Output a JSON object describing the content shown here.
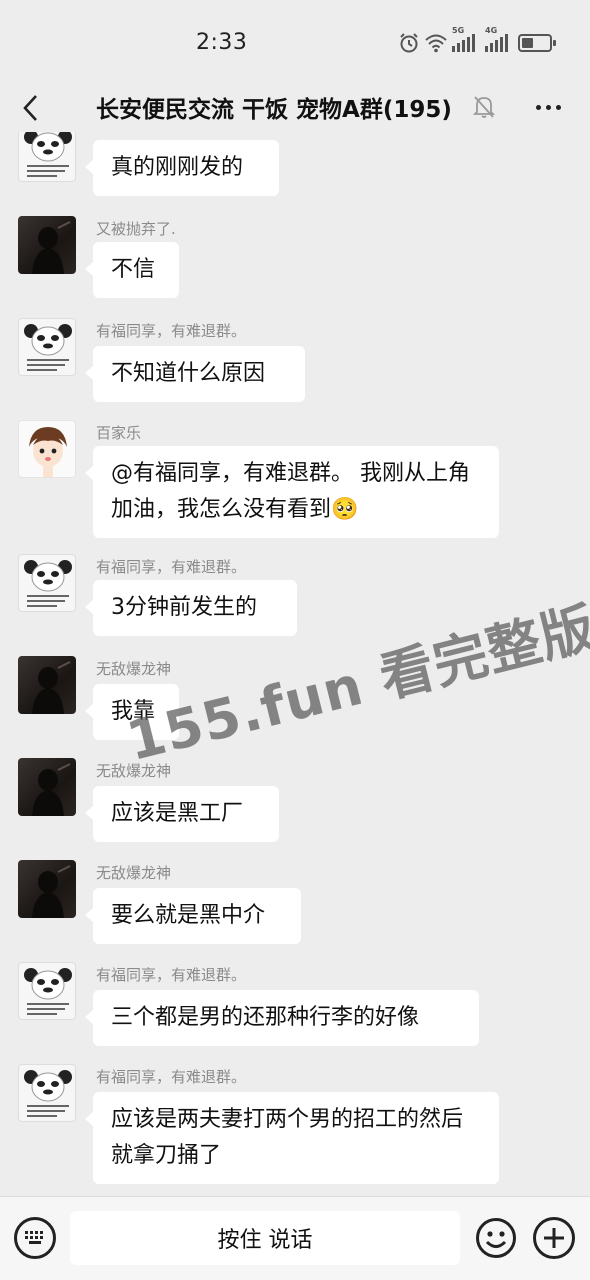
{
  "status_bar": {
    "time": "2:33",
    "network_1": "5G",
    "network_2": "4G",
    "icons": [
      "alarm-icon",
      "wifi-icon",
      "signal-5g-icon",
      "signal-4g-icon",
      "battery-icon"
    ],
    "battery_level": 0.35
  },
  "header": {
    "title": "长安便民交流 干饭 宠物A群(195)",
    "icons": [
      "back-icon",
      "mute-bell-icon",
      "more-icon"
    ]
  },
  "messages": [
    {
      "sender": "",
      "avatar": "panda",
      "text": "真的刚刚发的"
    },
    {
      "sender": "又被抛弃了.",
      "avatar": "dark",
      "text": "不信"
    },
    {
      "sender": "有福同享，有难退群。",
      "avatar": "panda",
      "text": "不知道什么原因"
    },
    {
      "sender": "百家乐",
      "avatar": "cartoon",
      "text": "@有福同享，有难退群。 我刚从上角加油，我怎么没有看到🥺"
    },
    {
      "sender": "有福同享，有难退群。",
      "avatar": "panda",
      "text": "3分钟前发生的"
    },
    {
      "sender": "无敌爆龙神",
      "avatar": "dark",
      "text": "我靠"
    },
    {
      "sender": "无敌爆龙神",
      "avatar": "dark",
      "text": "应该是黑工厂"
    },
    {
      "sender": "无敌爆龙神",
      "avatar": "dark",
      "text": "要么就是黑中介"
    },
    {
      "sender": "有福同享，有难退群。",
      "avatar": "panda",
      "text": "三个都是男的还那种行李的好像"
    },
    {
      "sender": "有福同享，有难退群。",
      "avatar": "panda",
      "text": "应该是两夫妻打两个男的招工的然后就拿刀捅了"
    }
  ],
  "watermark": "155.fun 看完整版",
  "input_bar": {
    "voice_label": "按住 说话",
    "icons": [
      "keyboard-icon",
      "emoji-icon",
      "plus-icon"
    ]
  },
  "colors": {
    "background": "#ededed",
    "bubble": "#ffffff",
    "sender_name": "#8a8a8a"
  }
}
